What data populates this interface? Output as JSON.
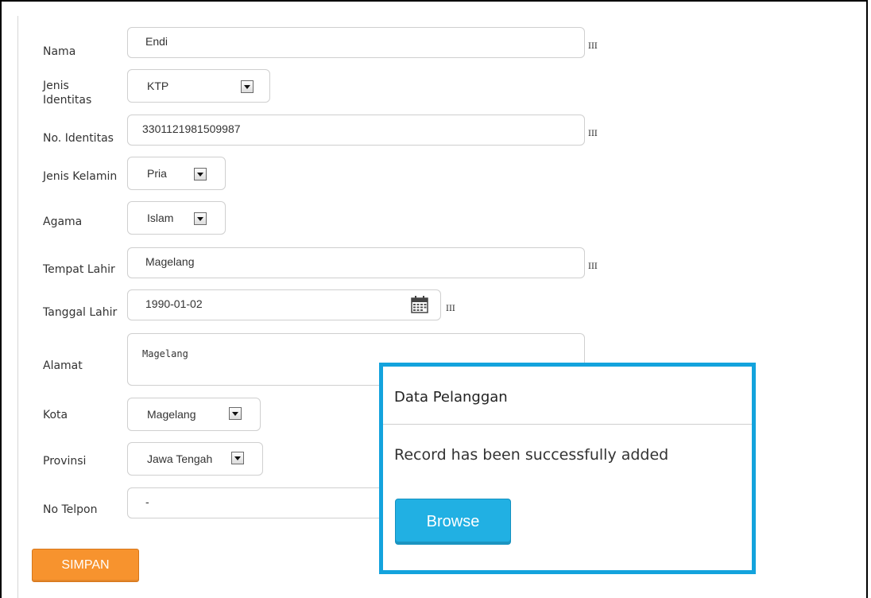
{
  "form": {
    "nama": {
      "label": "Nama",
      "value": "Endi",
      "required_mark": "III"
    },
    "jenis_identitas": {
      "label": "Jenis Identitas",
      "value": "KTP"
    },
    "no_identitas": {
      "label": "No. Identitas",
      "value": "3301121981509987",
      "required_mark": "III"
    },
    "jenis_kelamin": {
      "label": "Jenis Kelamin",
      "value": "Pria"
    },
    "agama": {
      "label": "Agama",
      "value": "Islam"
    },
    "tempat_lahir": {
      "label": "Tempat Lahir",
      "value": "Magelang",
      "required_mark": "III"
    },
    "tanggal_lahir": {
      "label": "Tanggal Lahir",
      "value": "1990-01-02",
      "required_mark": "III"
    },
    "alamat": {
      "label": "Alamat",
      "value": "Magelang"
    },
    "kota": {
      "label": "Kota",
      "value": "Magelang"
    },
    "provinsi": {
      "label": "Provinsi",
      "value": "Jawa Tengah"
    },
    "no_telpon": {
      "label": "No Telpon",
      "value": "-"
    },
    "submit_label": "SIMPAN"
  },
  "dialog": {
    "title": "Data Pelanggan",
    "message": "Record has been successfully added",
    "button_label": "Browse"
  },
  "colors": {
    "submit_button": "#f7932e",
    "dialog_border": "#13a3dd",
    "browse_button": "#21b0e3"
  },
  "icons": {
    "dropdown": "chevron-down-icon",
    "date_picker": "calendar-icon"
  }
}
